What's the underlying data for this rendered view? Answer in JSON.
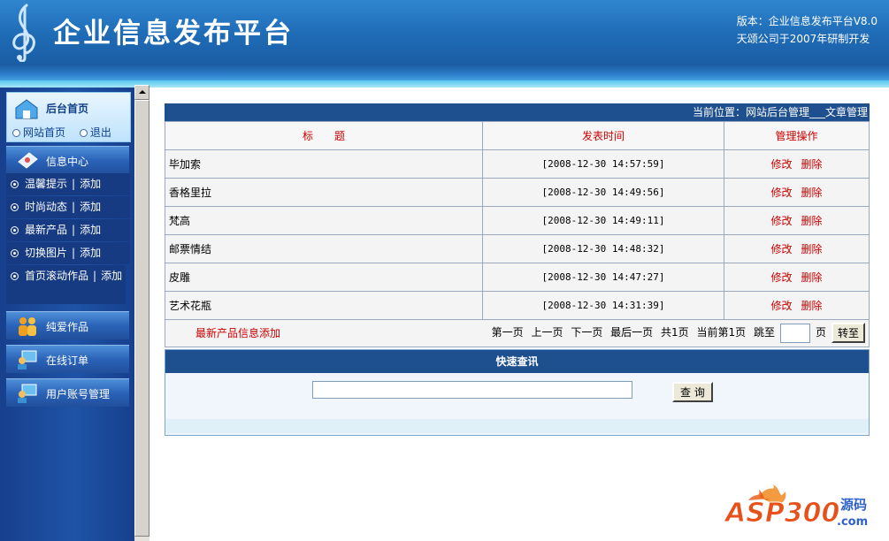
{
  "header": {
    "title": "企业信息发布平台",
    "version_line": "版本：企业信息发布平台V8.0",
    "credit_line": "天颂公司于2007年研制开发"
  },
  "sidebar": {
    "home": {
      "title": "后台首页",
      "site_home": "网站首页",
      "logout": "退出"
    },
    "info_center": "信息中心",
    "items": [
      {
        "label": "温馨提示",
        "add": "添加"
      },
      {
        "label": "时尚动态",
        "add": "添加"
      },
      {
        "label": "最新产品",
        "add": "添加"
      },
      {
        "label": "切换图片",
        "add": "添加"
      },
      {
        "label": "首页滚动作品",
        "add": "添加"
      }
    ],
    "sections": [
      "纯爱作品",
      "在线订单",
      "用户账号管理"
    ]
  },
  "main": {
    "location": "当前位置：网站后台管理___文章管理",
    "columns": [
      "标　　题",
      "发表时间",
      "管理操作"
    ],
    "rows": [
      {
        "title": "毕加索",
        "time": "[2008-12-30 14:57:59]",
        "edit": "修改",
        "delete": "删除"
      },
      {
        "title": "香格里拉",
        "time": "[2008-12-30 14:49:56]",
        "edit": "修改",
        "delete": "删除"
      },
      {
        "title": "梵高",
        "time": "[2008-12-30 14:49:11]",
        "edit": "修改",
        "delete": "删除"
      },
      {
        "title": "邮票情结",
        "time": "[2008-12-30 14:48:32]",
        "edit": "修改",
        "delete": "删除"
      },
      {
        "title": "皮雕",
        "time": "[2008-12-30 14:47:27]",
        "edit": "修改",
        "delete": "删除"
      },
      {
        "title": "艺术花瓶",
        "time": "[2008-12-30 14:31:39]",
        "edit": "修改",
        "delete": "删除"
      }
    ],
    "add_link": "最新产品信息添加",
    "pager": {
      "first": "第一页",
      "prev": "上一页",
      "next": "下一页",
      "last": "最后一页",
      "total": "共1页",
      "current": "当前第1页",
      "jump_to": "跳至",
      "page_unit": "页",
      "go_button": "转至",
      "page_input_value": ""
    },
    "quick_search": {
      "title": "快速查讯",
      "query_value": "",
      "button": "查 询"
    }
  },
  "logo": {
    "main": "ASP300",
    "cn": "源码",
    "domain": ".com"
  }
}
